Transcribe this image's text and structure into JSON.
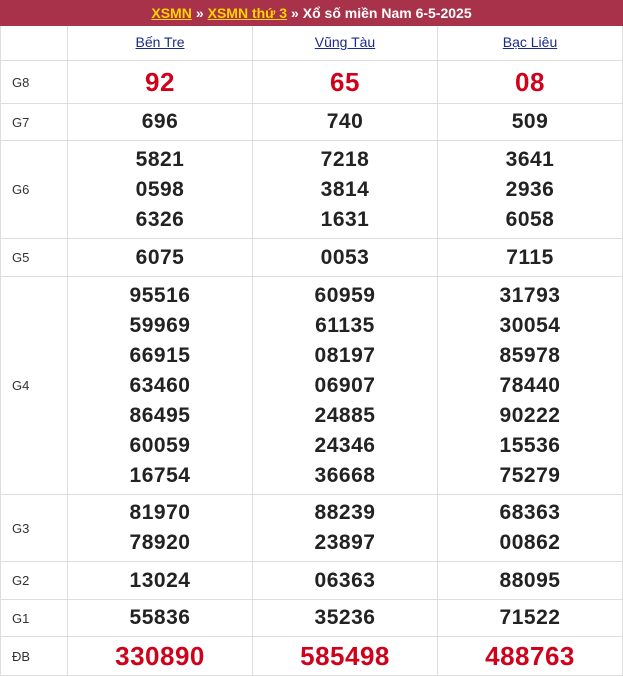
{
  "header": {
    "link1": "XSMN",
    "sep1": "»",
    "link2": "XSMN thứ 3",
    "sep2": "»",
    "title": "Xổ số miền Nam 6-5-2025"
  },
  "provinces": [
    "Bến Tre",
    "Vũng Tàu",
    "Bạc Liêu"
  ],
  "rows": {
    "g8": {
      "label": "G8",
      "values": [
        [
          "92"
        ],
        [
          "65"
        ],
        [
          "08"
        ]
      ]
    },
    "g7": {
      "label": "G7",
      "values": [
        [
          "696"
        ],
        [
          "740"
        ],
        [
          "509"
        ]
      ]
    },
    "g6": {
      "label": "G6",
      "values": [
        [
          "5821",
          "0598",
          "6326"
        ],
        [
          "7218",
          "3814",
          "1631"
        ],
        [
          "3641",
          "2936",
          "6058"
        ]
      ]
    },
    "g5": {
      "label": "G5",
      "values": [
        [
          "6075"
        ],
        [
          "0053"
        ],
        [
          "7115"
        ]
      ]
    },
    "g4": {
      "label": "G4",
      "values": [
        [
          "95516",
          "59969",
          "66915",
          "63460",
          "86495",
          "60059",
          "16754"
        ],
        [
          "60959",
          "61135",
          "08197",
          "06907",
          "24885",
          "24346",
          "36668"
        ],
        [
          "31793",
          "30054",
          "85978",
          "78440",
          "90222",
          "15536",
          "75279"
        ]
      ]
    },
    "g3": {
      "label": "G3",
      "values": [
        [
          "81970",
          "78920"
        ],
        [
          "88239",
          "23897"
        ],
        [
          "68363",
          "00862"
        ]
      ]
    },
    "g2": {
      "label": "G2",
      "values": [
        [
          "13024"
        ],
        [
          "06363"
        ],
        [
          "88095"
        ]
      ]
    },
    "g1": {
      "label": "G1",
      "values": [
        [
          "55836"
        ],
        [
          "35236"
        ],
        [
          "71522"
        ]
      ]
    },
    "db": {
      "label": "ĐB",
      "values": [
        [
          "330890"
        ],
        [
          "585498"
        ],
        [
          "488763"
        ]
      ]
    }
  },
  "colors": {
    "header_bg": "#a8324a",
    "header_link": "#ffd400",
    "special_red": "#d0021b",
    "province_link": "#1a2a8c"
  }
}
